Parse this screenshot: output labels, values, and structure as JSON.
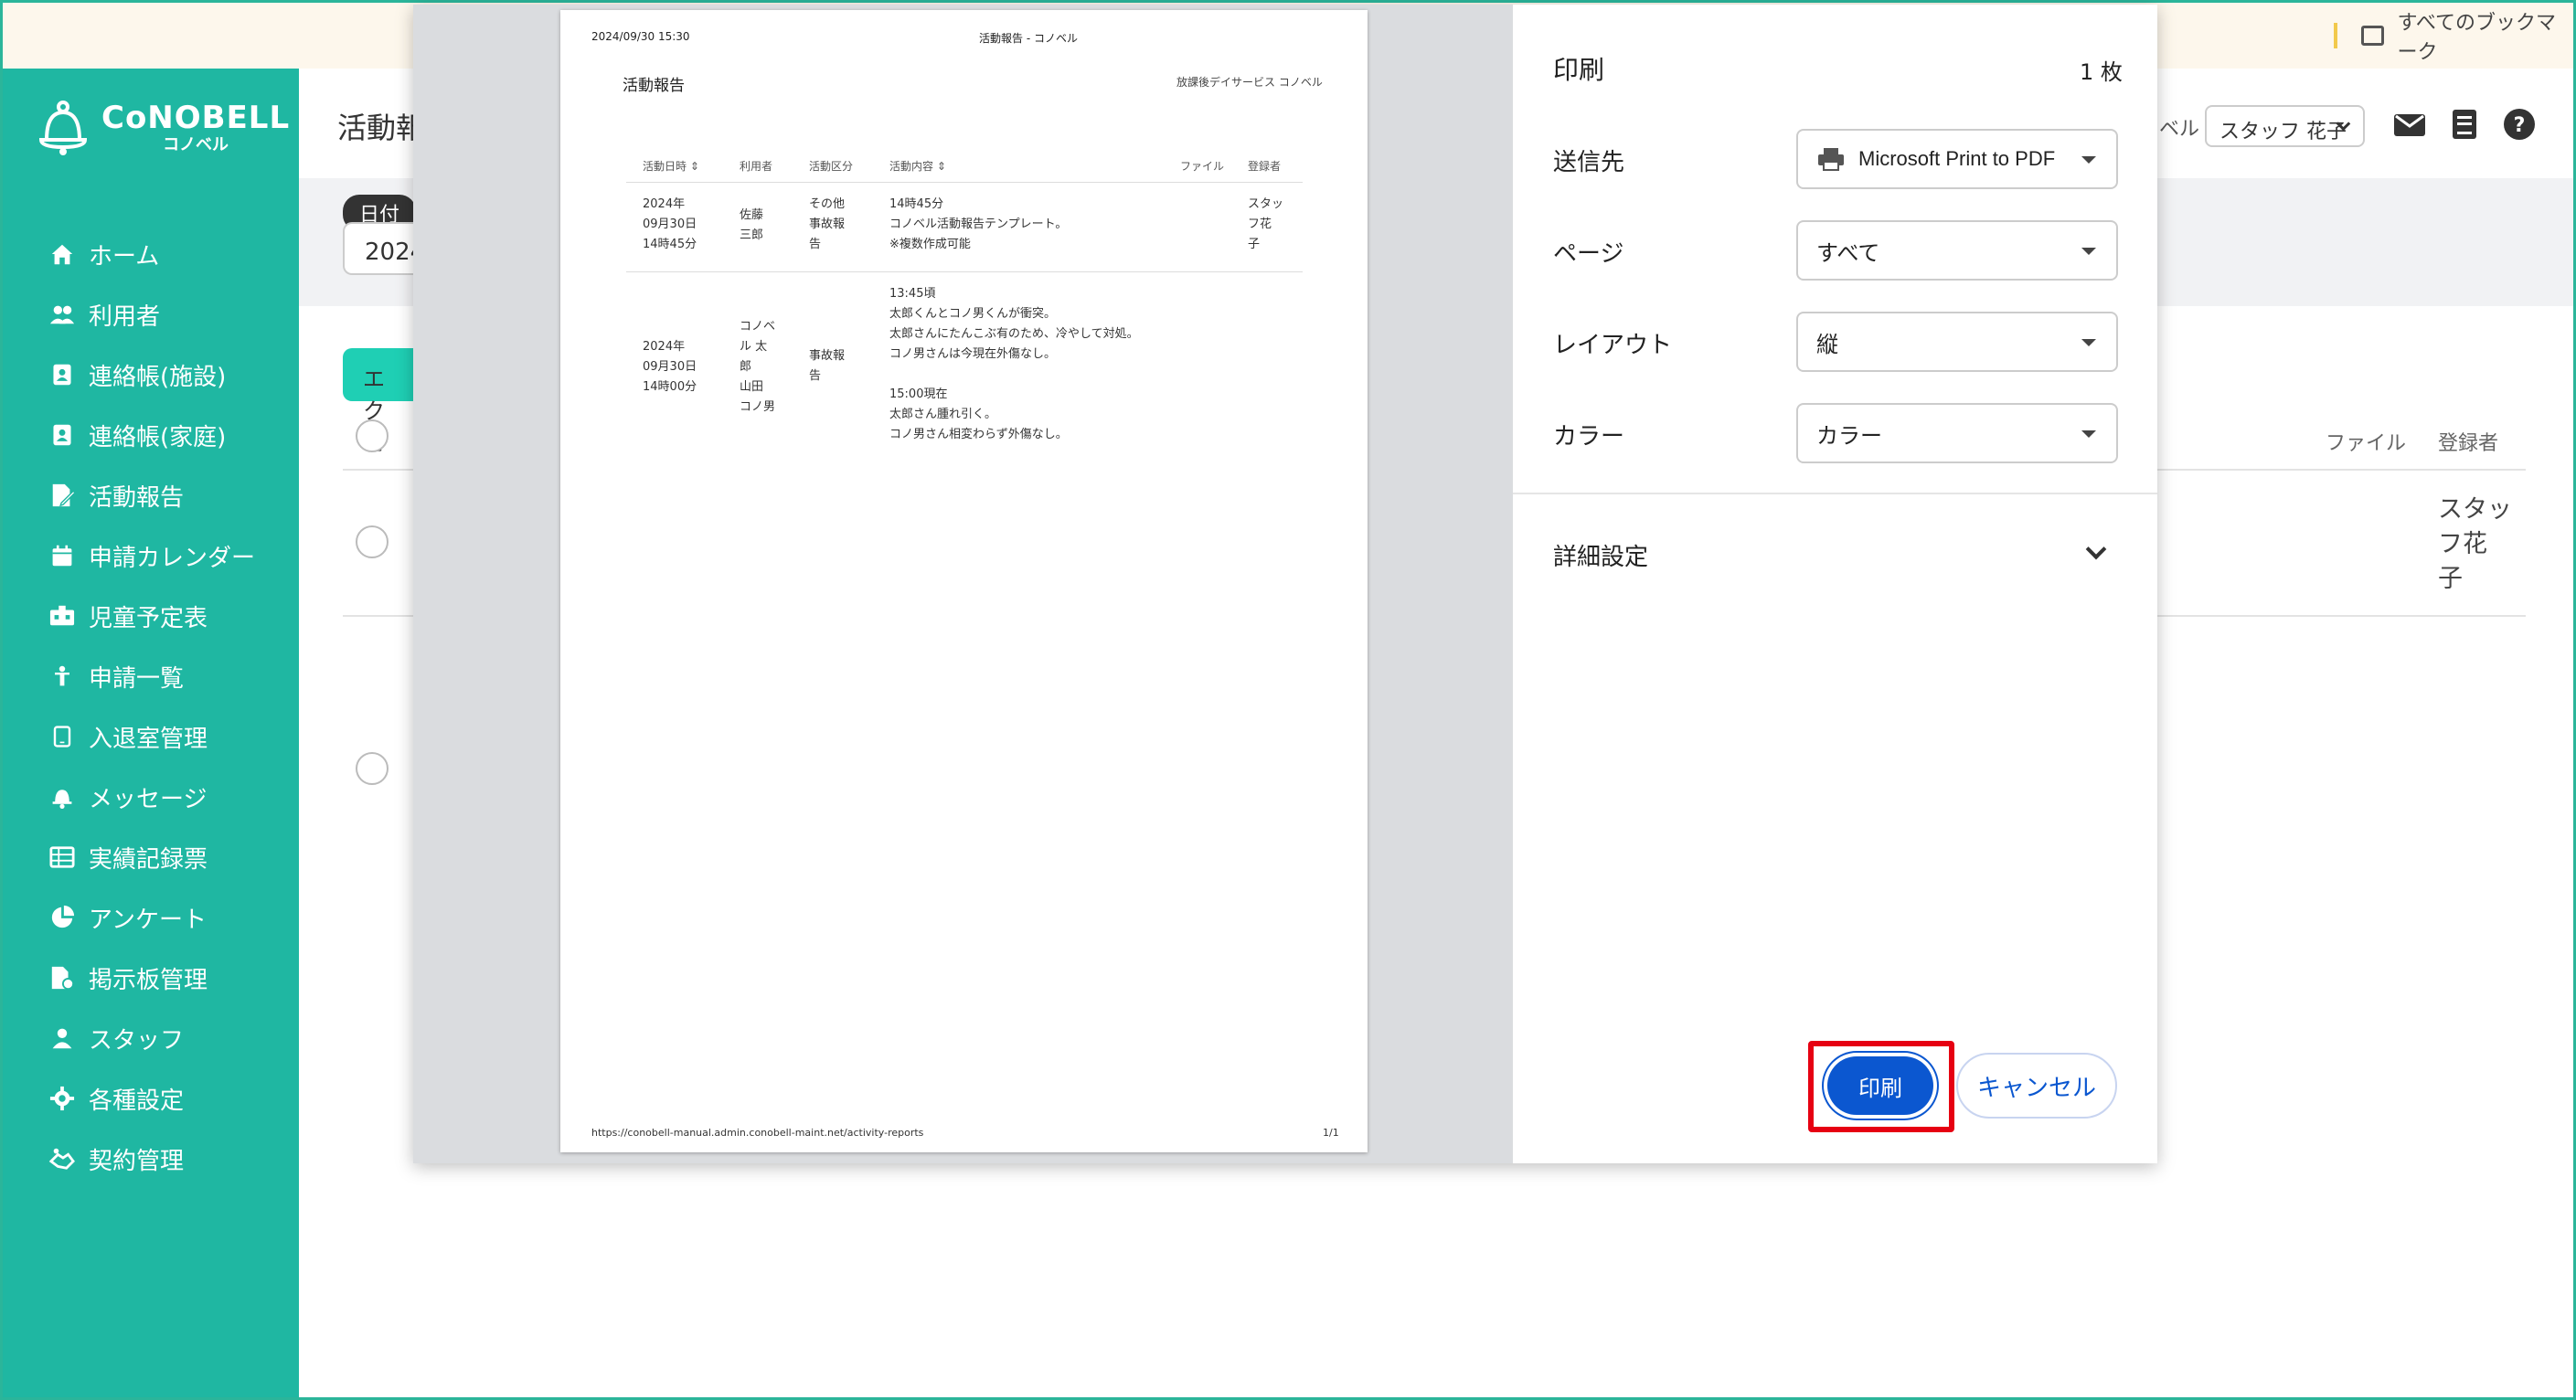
{
  "bookmark_bar": {
    "all_bookmarks": "すべてのブックマーク"
  },
  "brand": {
    "name": "CoNOBELL",
    "sub": "コノベル"
  },
  "sidebar": {
    "items": [
      {
        "label": "ホーム",
        "icon": "home-icon"
      },
      {
        "label": "利用者",
        "icon": "users-icon"
      },
      {
        "label": "連絡帳(施設)",
        "icon": "contact-book-icon"
      },
      {
        "label": "連絡帳(家庭)",
        "icon": "contact-book-icon"
      },
      {
        "label": "活動報告",
        "icon": "report-edit-icon"
      },
      {
        "label": "申請カレンダー",
        "icon": "calendar-icon"
      },
      {
        "label": "児童予定表",
        "icon": "schedule-icon"
      },
      {
        "label": "申請一覧",
        "icon": "child-icon"
      },
      {
        "label": "入退室管理",
        "icon": "tablet-icon"
      },
      {
        "label": "メッセージ",
        "icon": "bell-icon"
      },
      {
        "label": "実績記録票",
        "icon": "table-icon"
      },
      {
        "label": "アンケート",
        "icon": "pie-chart-icon"
      },
      {
        "label": "掲示板管理",
        "icon": "board-file-icon"
      },
      {
        "label": "スタッフ",
        "icon": "staff-icon"
      },
      {
        "label": "各種設定",
        "icon": "gear-icon"
      },
      {
        "label": "契約管理",
        "icon": "handshake-icon"
      }
    ]
  },
  "header": {
    "title_partial": "活動報",
    "level_partial": "ベル",
    "staff": "スタッフ 花子"
  },
  "filter": {
    "date_chip": "日付",
    "date_partial": "2024"
  },
  "toolbar": {
    "excel_partial": "エクセ"
  },
  "table": {
    "col_file": "ファイル",
    "col_registrant": "登録者",
    "row1_registrant": [
      "スタッ",
      "フ花",
      "子"
    ]
  },
  "preview": {
    "header_datetime": "2024/09/30 15:30",
    "header_title": "活動報告 - コノベル",
    "title": "活動報告",
    "org": "放課後デイサービス コノベル",
    "columns": [
      "活動日時 ⇕",
      "利用者",
      "活動区分",
      "活動内容 ⇕",
      "ファイル",
      "登録者"
    ],
    "rows": [
      {
        "date": "2024年\n09月30日\n14時45分",
        "user": "佐藤\n三郎",
        "category": "その他\n事故報\n告",
        "content": "14時45分\nコノベル活動報告テンプレート。\n※複数作成可能",
        "registrant": "スタッ\nフ花\n子"
      },
      {
        "date": "2024年\n09月30日\n14時00分",
        "user": "コノベ\nル 太\n郎\n山田\nコノ男",
        "category": "事故報\n告",
        "content": "13:45頃\n太郎くんとコノ男くんが衝突。\n太郎さんにたんこぶ有のため、冷やして対処。\nコノ男さんは今現在外傷なし。\n\n15:00現在\n太郎さん腫れ引く。\nコノ男さん相変わらず外傷なし。",
        "registrant": ""
      }
    ],
    "footer_url": "https://conobell-manual.admin.conobell-maint.net/activity-reports",
    "footer_page": "1/1"
  },
  "print": {
    "title": "印刷",
    "sheet_count": "1 枚",
    "destination_label": "送信先",
    "destination_value": "Microsoft Print to PDF",
    "pages_label": "ページ",
    "pages_value": "すべて",
    "layout_label": "レイアウト",
    "layout_value": "縦",
    "color_label": "カラー",
    "color_value": "カラー",
    "more_settings": "詳細設定",
    "print_button": "印刷",
    "cancel_button": "キャンセル"
  },
  "colors": {
    "sidebar": "#1fb7a2",
    "print_button": "#0b57d0",
    "highlight": "#e60012"
  }
}
